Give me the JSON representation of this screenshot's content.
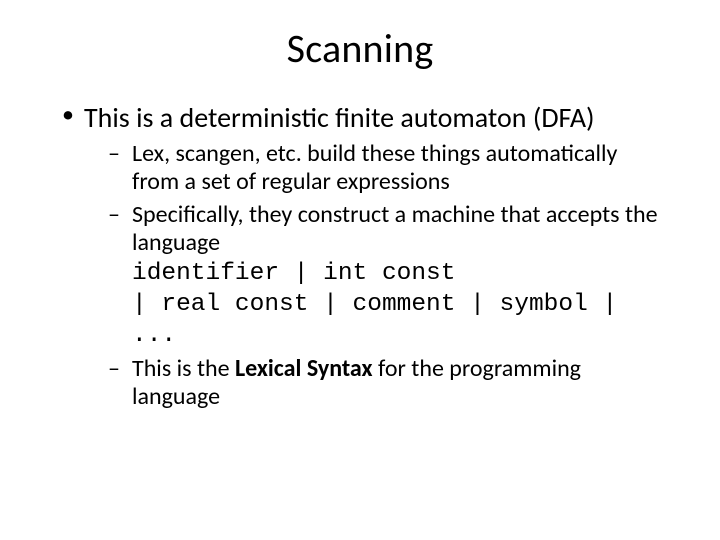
{
  "title": "Scanning",
  "bullets": {
    "l1_0": "This is a deterministic finite automaton (DFA)",
    "l2_0": "Lex, scangen, etc. build these things automatically from a set of regular expressions",
    "l2_1": "Specifically, they construct a machine that accepts the language",
    "code": "identifier | int const\n| real const | comment | symbol |\n...",
    "l2_2a": "This is the ",
    "l2_2b": "Lexical Syntax",
    "l2_2c": " for the programming language"
  }
}
